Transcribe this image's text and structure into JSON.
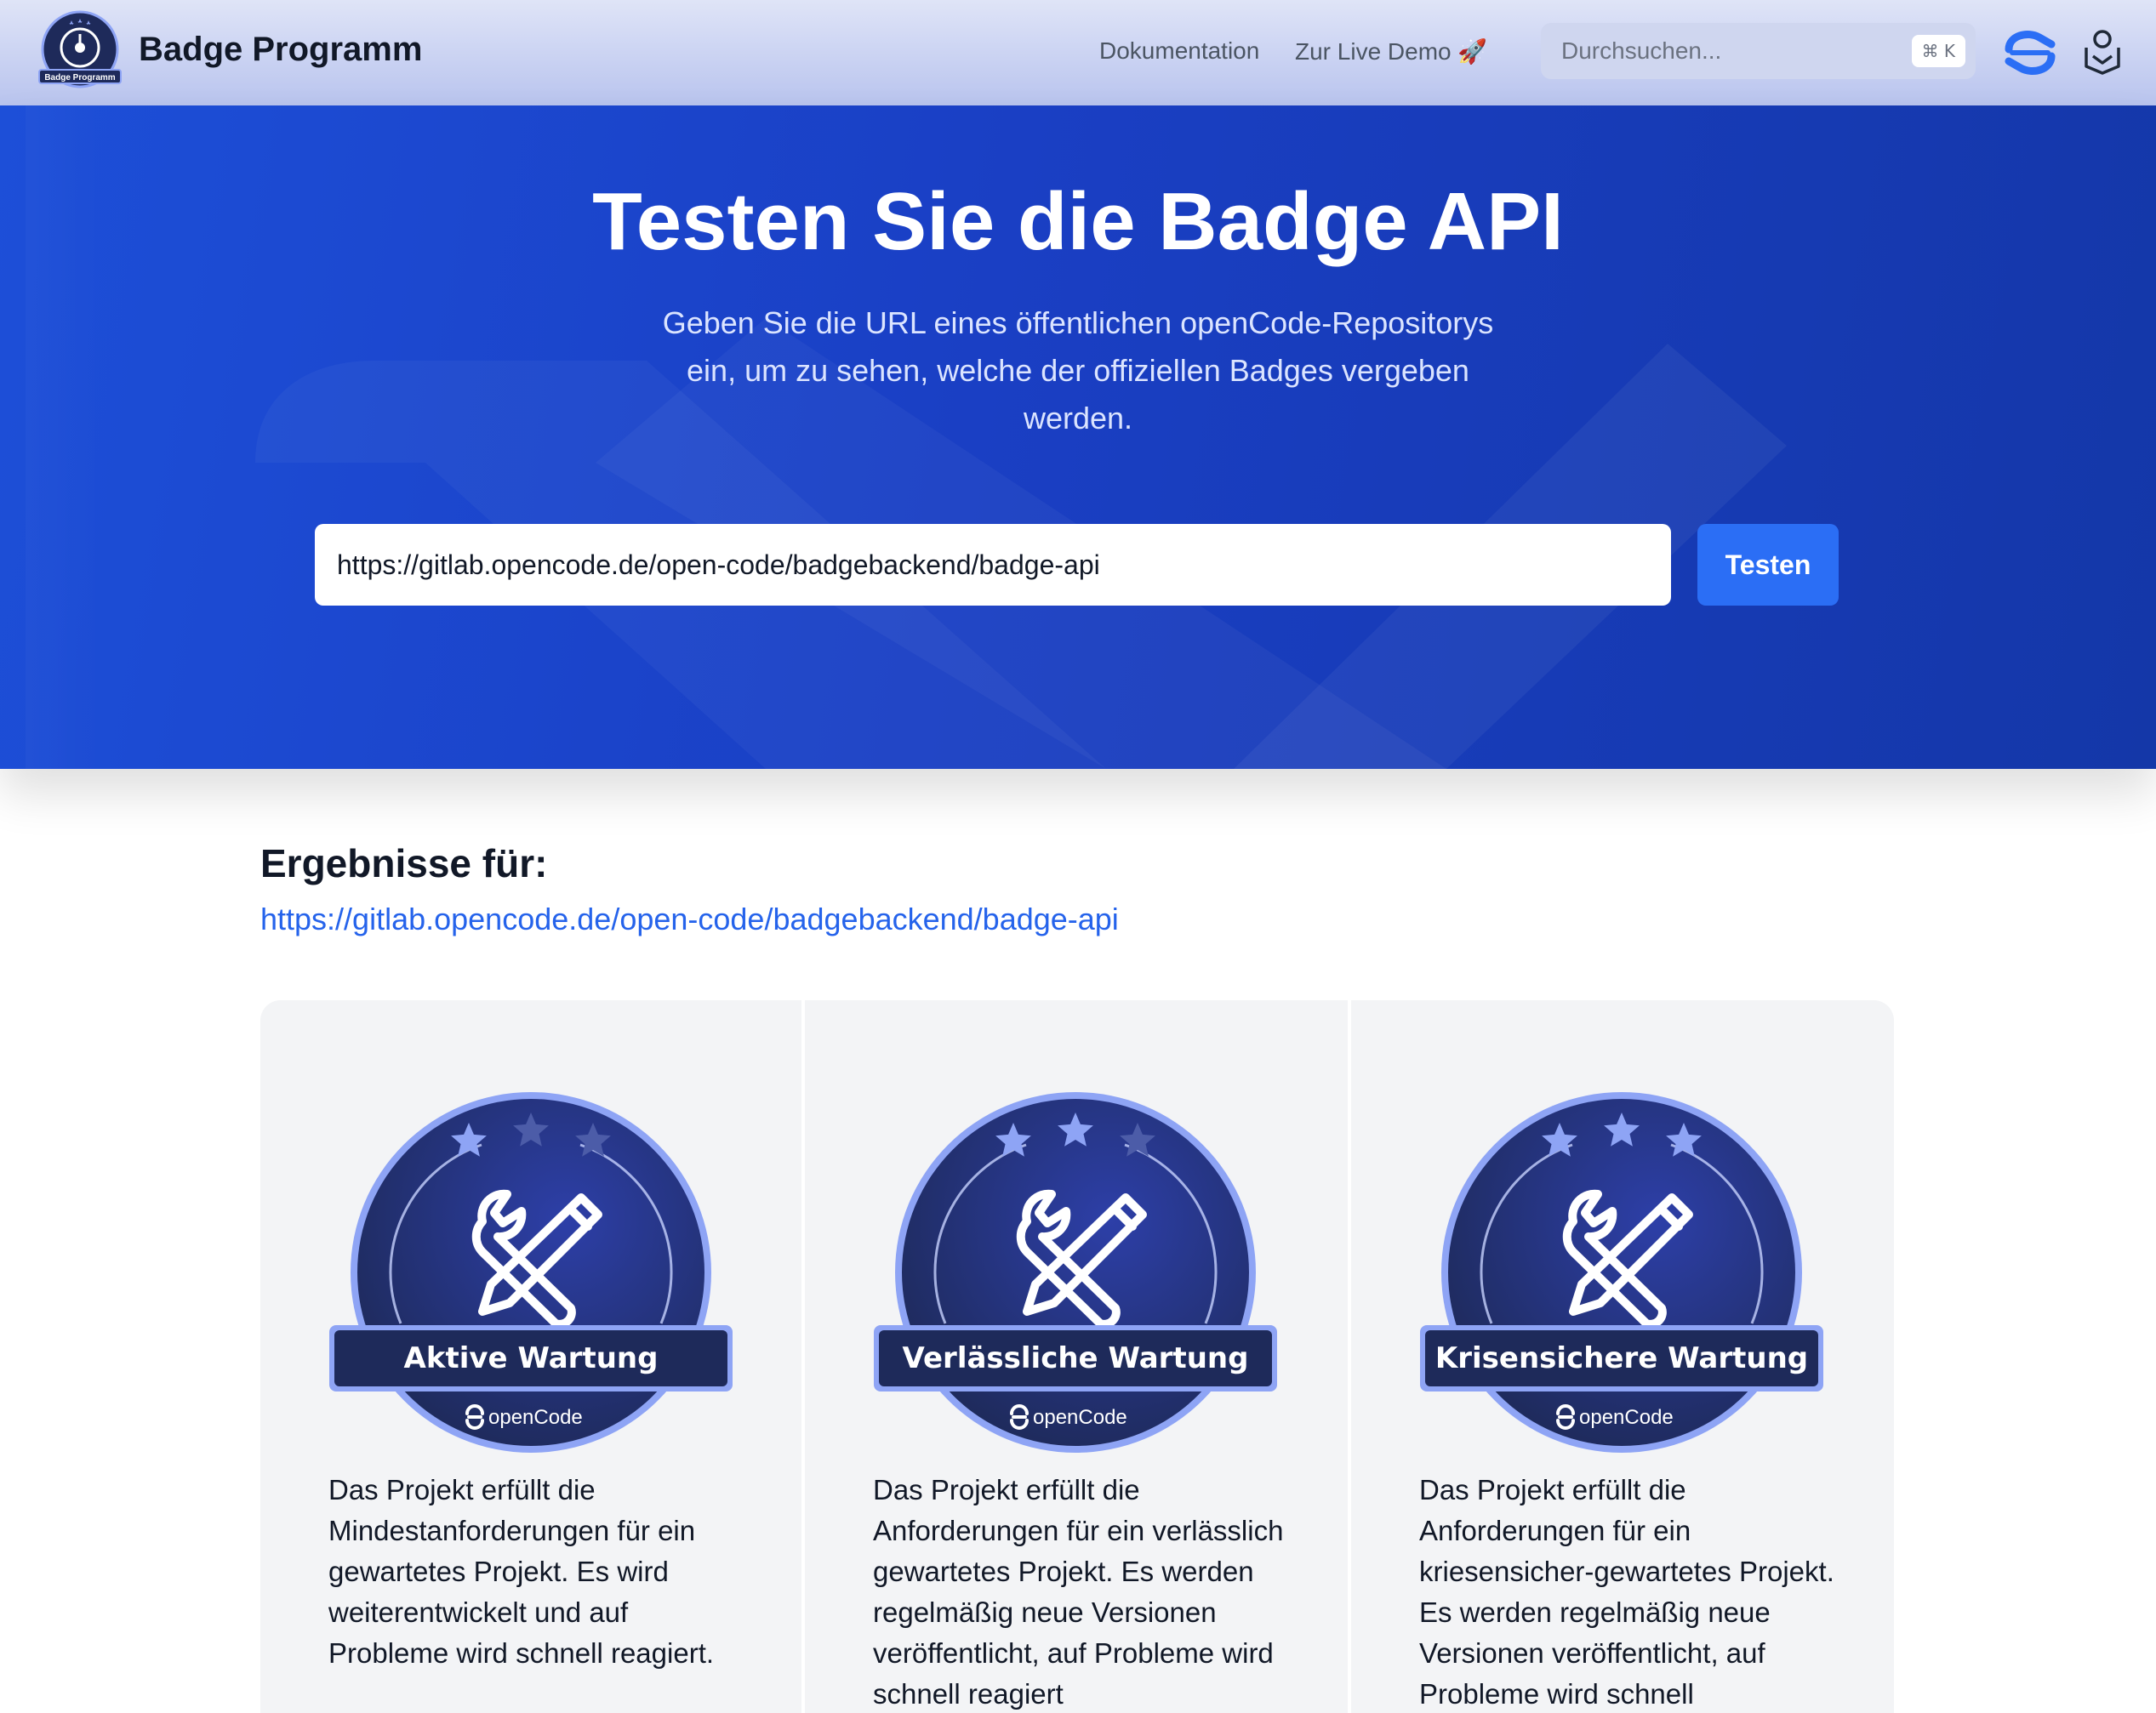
{
  "header": {
    "brand": "Badge Programm",
    "logo_text": "Badge Programm",
    "nav": [
      {
        "label": "Dokumentation"
      },
      {
        "label": "Zur Live Demo 🚀"
      }
    ],
    "search": {
      "placeholder": "Durchsuchen...",
      "shortcut": "⌘ K"
    }
  },
  "hero": {
    "title": "Testen Sie die Badge API",
    "subtitle": "Geben Sie die URL eines öffentlichen openCode-Repositorys ein, um zu sehen, welche der offiziellen Badges vergeben werden.",
    "input_value": "https://gitlab.opencode.de/open-code/badgebackend/badge-api",
    "button_label": "Testen"
  },
  "results": {
    "heading": "Ergebnisse für:",
    "url": "https://gitlab.opencode.de/open-code/badgebackend/badge-api",
    "badges": [
      {
        "title": "Aktive Wartung",
        "brand": "openCode",
        "stars_filled": 1,
        "description": "Das Projekt erfüllt die Mindestanforderungen für ein gewartetes Projekt. Es wird weiterentwickelt und auf Probleme wird schnell reagiert."
      },
      {
        "title": "Verlässliche Wartung",
        "brand": "openCode",
        "stars_filled": 2,
        "description": "Das Projekt erfüllt die Anforderungen für ein verlässlich gewartetes Projekt. Es werden regelmäßig neue Versionen veröffentlicht, auf Probleme wird schnell reagiert"
      },
      {
        "title": "Krisensichere Wartung",
        "brand": "openCode",
        "stars_filled": 3,
        "description": "Das Projekt erfüllt die Anforderungen für ein kriesensicher-gewartetes Projekt. Es werden regelmäßig neue Versionen veröffentlicht, auf Probleme wird schnell"
      }
    ]
  },
  "colors": {
    "hero_blue": "#1d4fd8",
    "button_blue": "#2b6ef5",
    "link_blue": "#2563eb",
    "badge_navy": "#1e2a5a",
    "badge_ring": "#8ea4f5"
  },
  "icons": [
    "badge-programm-logo",
    "opencode-icon",
    "badge-icon",
    "wrench-pencil-icon",
    "star-icon"
  ]
}
